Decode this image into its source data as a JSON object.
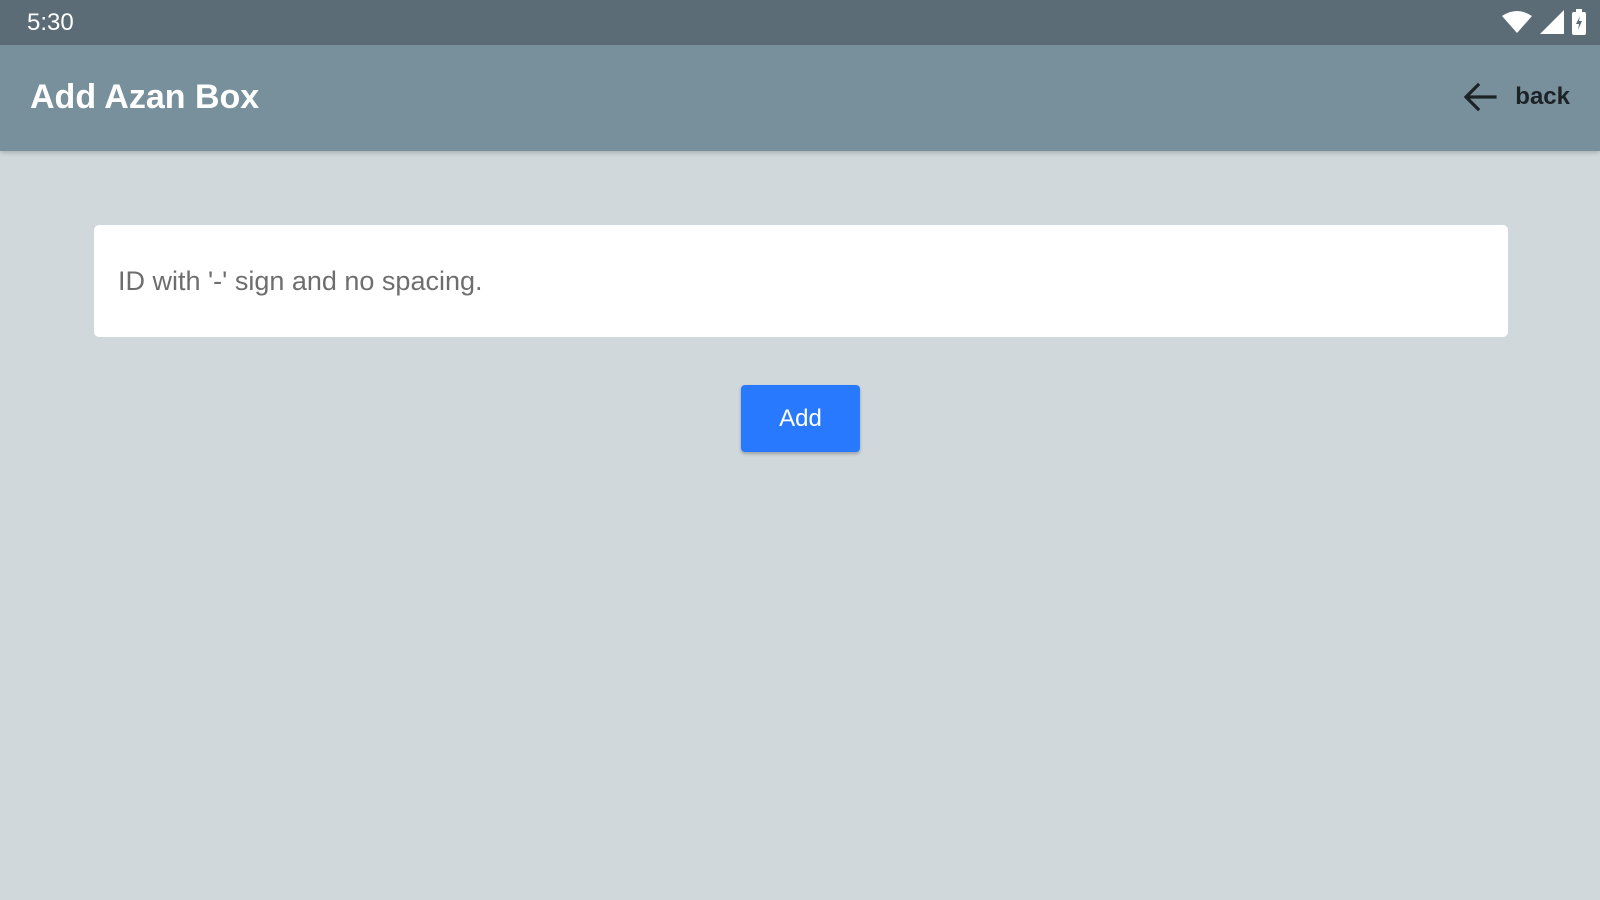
{
  "status_bar": {
    "time": "5:30",
    "icons": [
      "wifi-icon",
      "cellular-signal-icon",
      "battery-icon"
    ]
  },
  "app_bar": {
    "title": "Add Azan Box",
    "back_label": "back",
    "back_icon": "arrow-left-icon"
  },
  "form": {
    "id_input": {
      "value": "",
      "placeholder": "ID with '-' sign and no spacing."
    },
    "add_label": "Add"
  },
  "colors": {
    "status_bar": "#5b6c77",
    "app_bar": "#78909c",
    "background": "#d0d8dc",
    "accent": "#2979ff"
  }
}
